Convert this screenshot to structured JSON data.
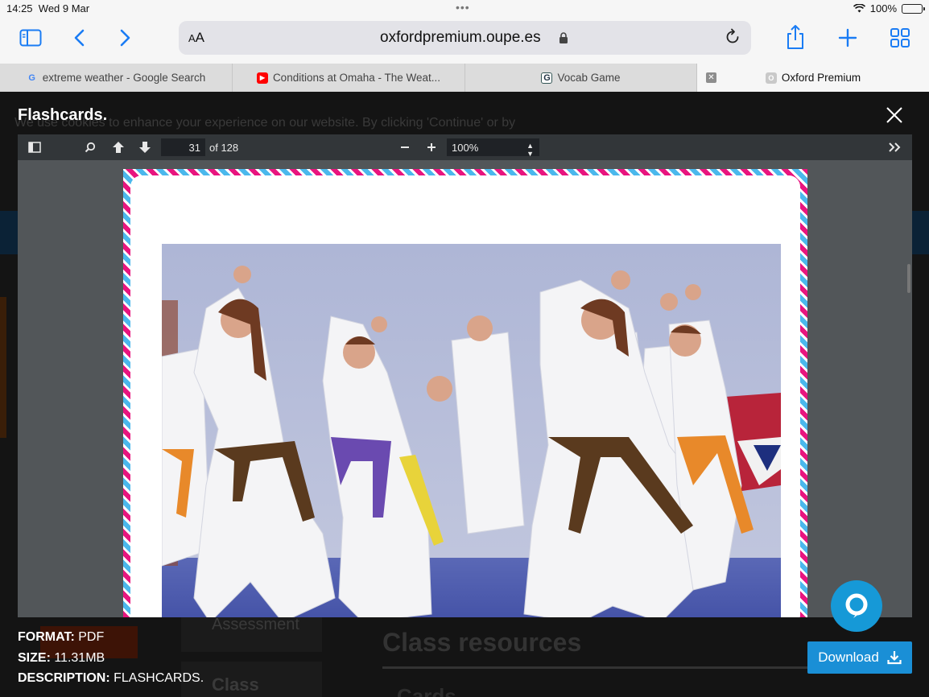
{
  "status": {
    "time": "14:25",
    "date": "Wed 9 Mar",
    "battery": "100%"
  },
  "browser": {
    "aa_label": "A",
    "aa_label_big": "A",
    "url": "oxfordpremium.oupe.es",
    "tabs": [
      {
        "title": "extreme weather - Google Search",
        "icon": "google-icon"
      },
      {
        "title": "Conditions at Omaha - The Weat...",
        "icon": "youtube-icon"
      },
      {
        "title": "Vocab Game",
        "icon": "vocab-game-icon"
      },
      {
        "title": "Oxford Premium",
        "icon": "oxford-icon",
        "active": true
      }
    ]
  },
  "background_page": {
    "cookie_text": "We use cookies to enhance your experience on our website. By clicking 'Continue' or by",
    "sidebar_item": "Assessment",
    "sidebar_item_2": "Class",
    "heading": "Class resources",
    "subheading": "Cards"
  },
  "modal": {
    "title": "Flashcards.",
    "pdf": {
      "page": "31",
      "of_label": "of 128",
      "zoom": "100%"
    },
    "format_label": "FORMAT:",
    "format_value": "PDF",
    "size_label": "SIZE:",
    "size_value": "11.31MB",
    "description_label": "DESCRIPTION:",
    "description_value": "FLASHCARDS.",
    "download_label": "Download"
  },
  "colors": {
    "accent": "#1a7cf4",
    "download": "#1a8fd6",
    "chat": "#1699d7",
    "border_pink": "#e8157f",
    "border_blue": "#4bb8ec"
  }
}
